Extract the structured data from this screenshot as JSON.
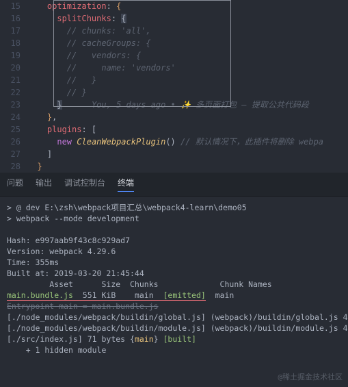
{
  "editor": {
    "lines": [
      {
        "n": "15",
        "indent": 2,
        "tokens": [
          {
            "c": "k-prop",
            "t": "optimization"
          },
          {
            "c": "k-punc",
            "t": ": "
          },
          {
            "c": "k-brace",
            "t": "{"
          }
        ]
      },
      {
        "n": "16",
        "indent": 3,
        "tokens": [
          {
            "c": "k-prop",
            "t": "splitChunks"
          },
          {
            "c": "k-punc",
            "t": ": "
          },
          {
            "c": "hlbrace",
            "t": "{"
          }
        ]
      },
      {
        "n": "17",
        "indent": 4,
        "tokens": [
          {
            "c": "k-comment",
            "t": "// chunks: 'all',"
          }
        ]
      },
      {
        "n": "18",
        "indent": 4,
        "tokens": [
          {
            "c": "k-comment",
            "t": "// cacheGroups: {"
          }
        ]
      },
      {
        "n": "19",
        "indent": 4,
        "tokens": [
          {
            "c": "k-comment",
            "t": "//   vendors: {"
          }
        ]
      },
      {
        "n": "20",
        "indent": 4,
        "tokens": [
          {
            "c": "k-comment",
            "t": "//     name: 'vendors'"
          }
        ]
      },
      {
        "n": "21",
        "indent": 4,
        "tokens": [
          {
            "c": "k-comment",
            "t": "//   }"
          }
        ]
      },
      {
        "n": "22",
        "indent": 4,
        "tokens": [
          {
            "c": "k-comment",
            "t": "// }"
          }
        ]
      },
      {
        "n": "23",
        "indent": 3,
        "tokens": [
          {
            "c": "hlbrace",
            "t": "}"
          }
        ],
        "gitlens": "You, 5 days ago • ✨ 多页面打包 — 提取公共代码段"
      },
      {
        "n": "24",
        "indent": 2,
        "tokens": [
          {
            "c": "k-brace",
            "t": "}"
          },
          {
            "c": "k-punc",
            "t": ","
          }
        ]
      },
      {
        "n": "25",
        "indent": 2,
        "tokens": [
          {
            "c": "k-prop",
            "t": "plugins"
          },
          {
            "c": "k-punc",
            "t": ": ["
          }
        ]
      },
      {
        "n": "26",
        "indent": 3,
        "tokens": [
          {
            "c": "k-new",
            "t": "new "
          },
          {
            "c": "k-class",
            "t": "CleanWebpackPlugin"
          },
          {
            "c": "k-paren",
            "t": "() "
          },
          {
            "c": "k-comment",
            "t": "// 默认情况下，此插件将删除 webpa"
          }
        ]
      },
      {
        "n": "27",
        "indent": 2,
        "tokens": [
          {
            "c": "k-punc",
            "t": "]"
          }
        ]
      },
      {
        "n": "28",
        "indent": 1,
        "tokens": [
          {
            "c": "k-brace",
            "t": "}"
          }
        ]
      }
    ]
  },
  "tabs": {
    "items": [
      "问题",
      "输出",
      "调试控制台",
      "终端"
    ],
    "active": 3
  },
  "terminal": {
    "lines": [
      {
        "spans": [
          {
            "c": "t-grey",
            "t": "> @ dev E:\\zsh\\webpack项目汇总\\webpack4-learn\\demo05"
          }
        ]
      },
      {
        "spans": [
          {
            "c": "t-grey",
            "t": "> webpack --mode development"
          }
        ]
      },
      {
        "spans": [
          {
            "c": "",
            "t": " "
          }
        ]
      },
      {
        "spans": [
          {
            "c": "t-grey",
            "t": "Hash: "
          },
          {
            "c": "t-grey",
            "t": "e997aab9f43c8c929ad7"
          }
        ]
      },
      {
        "spans": [
          {
            "c": "t-grey",
            "t": "Version: webpack "
          },
          {
            "c": "t-grey",
            "t": "4.29.6"
          }
        ]
      },
      {
        "spans": [
          {
            "c": "t-grey",
            "t": "Time: "
          },
          {
            "c": "t-grey",
            "t": "355"
          },
          {
            "c": "t-grey",
            "t": "ms"
          }
        ]
      },
      {
        "spans": [
          {
            "c": "t-grey",
            "t": "Built at: 2019-03-20 21:45:44"
          }
        ]
      },
      {
        "spans": [
          {
            "c": "t-grey",
            "t": "         Asset      Size  Chunks             Chunk Names"
          }
        ]
      },
      {
        "spans": [
          {
            "c": "t-green underline-red",
            "t": "main.bundle.js"
          },
          {
            "c": "t-grey underline-red",
            "t": "  551 KiB    main  "
          },
          {
            "c": "t-green underline-red",
            "t": "[emitted]"
          },
          {
            "c": "t-grey",
            "t": "  main"
          }
        ]
      },
      {
        "spans": [
          {
            "c": "strike",
            "t": "Entrypoint main = main.bundle.js"
          }
        ]
      },
      {
        "spans": [
          {
            "c": "t-grey",
            "t": "[./node_modules/webpack/buildin/global.js] (webpack)/buildin/global.js 4"
          }
        ]
      },
      {
        "spans": [
          {
            "c": "t-grey",
            "t": "[./node_modules/webpack/buildin/module.js] (webpack)/buildin/module.js 4"
          }
        ]
      },
      {
        "spans": [
          {
            "c": "t-grey",
            "t": "[./src/index.js] 71 bytes {"
          },
          {
            "c": "t-yellow",
            "t": "main"
          },
          {
            "c": "t-grey",
            "t": "} "
          },
          {
            "c": "t-green",
            "t": "[built]"
          }
        ]
      },
      {
        "spans": [
          {
            "c": "t-grey",
            "t": "    + 1 hidden module"
          }
        ]
      }
    ]
  },
  "watermark": "@稀土掘金技术社区"
}
